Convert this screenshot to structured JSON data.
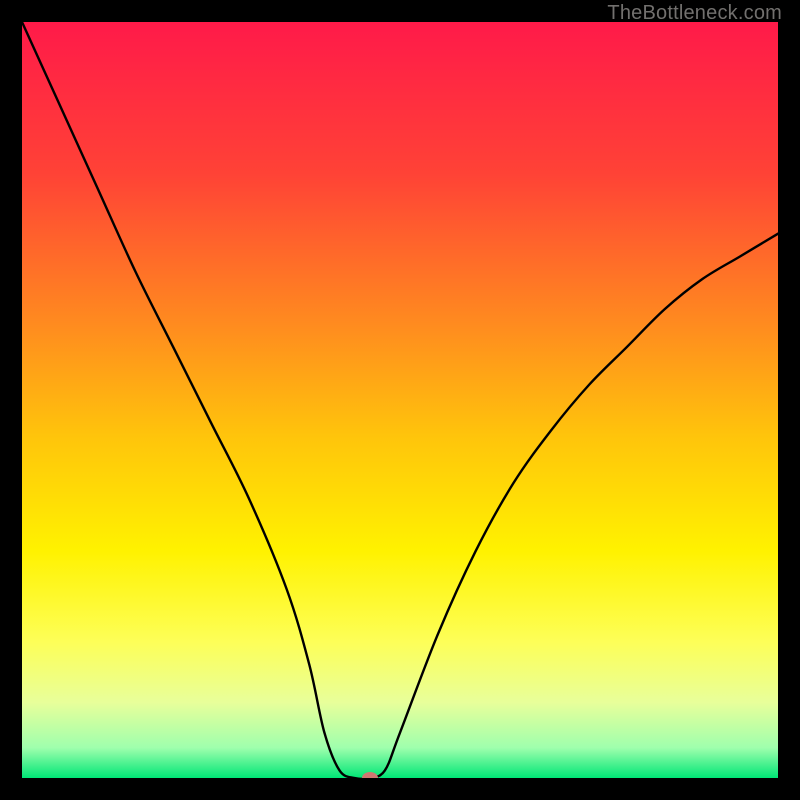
{
  "watermark": "TheBottleneck.com",
  "chart_data": {
    "type": "line",
    "title": "",
    "xlabel": "",
    "ylabel": "",
    "xlim": [
      0,
      100
    ],
    "ylim": [
      0,
      100
    ],
    "grid": false,
    "legend": false,
    "background_gradient_stops": [
      {
        "pos": 0.0,
        "color": "#ff1a49"
      },
      {
        "pos": 0.2,
        "color": "#ff4236"
      },
      {
        "pos": 0.4,
        "color": "#ff8b1f"
      },
      {
        "pos": 0.55,
        "color": "#ffc50b"
      },
      {
        "pos": 0.7,
        "color": "#fff200"
      },
      {
        "pos": 0.82,
        "color": "#fdff58"
      },
      {
        "pos": 0.9,
        "color": "#e8ff9a"
      },
      {
        "pos": 0.96,
        "color": "#9fffad"
      },
      {
        "pos": 1.0,
        "color": "#00e676"
      }
    ],
    "series": [
      {
        "name": "bottleneck-curve",
        "color": "#000000",
        "x": [
          0,
          5,
          10,
          15,
          20,
          25,
          30,
          35,
          38,
          40,
          42,
          44,
          46,
          48,
          50,
          55,
          60,
          65,
          70,
          75,
          80,
          85,
          90,
          95,
          100
        ],
        "y": [
          100,
          89,
          78,
          67,
          57,
          47,
          37,
          25,
          15,
          6,
          1,
          0,
          0,
          1,
          6,
          19,
          30,
          39,
          46,
          52,
          57,
          62,
          66,
          69,
          72
        ]
      }
    ],
    "marker": {
      "x": 46,
      "y": 0,
      "color": "#cf7771"
    }
  }
}
